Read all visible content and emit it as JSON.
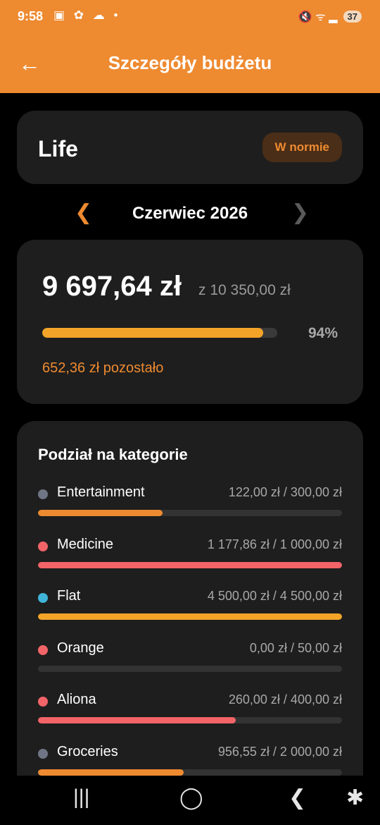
{
  "status": {
    "time": "9:58",
    "left_icons": "▣ ✿ ☁ •",
    "right_icons": "🔇 ᯤ ▂",
    "battery": "37"
  },
  "header": {
    "back_icon": "←",
    "title": "Szczegóły budżetu"
  },
  "budget": {
    "name": "Life",
    "status_badge": "W normie"
  },
  "month_nav": {
    "prev_icon": "❮",
    "label": "Czerwiec 2026",
    "next_icon": "❯"
  },
  "summary": {
    "spent": "9 697,64 zł",
    "limit": "z 10 350,00 zł",
    "percent_label": "94%",
    "progress": 0.94,
    "remaining": "652,36 zł pozostało",
    "bar_color": "#f3a428"
  },
  "categories": {
    "heading": "Podział na kategorie",
    "items": [
      {
        "name": "Entertainment",
        "amount": "122,00 zł / 300,00 zł",
        "progress": 0.41,
        "dot_color": "#6f7584",
        "bar_color": "#ee8a30"
      },
      {
        "name": "Medicine",
        "amount": "1 177,86 zł / 1 000,00 zł",
        "progress": 1.0,
        "dot_color": "#f26468",
        "bar_color": "#f26468"
      },
      {
        "name": "Flat",
        "amount": "4 500,00 zł / 4 500,00 zł",
        "progress": 1.0,
        "dot_color": "#3fb4d8",
        "bar_color": "#f3a428"
      },
      {
        "name": "Orange",
        "amount": "0,00 zł / 50,00 zł",
        "progress": 0.0,
        "dot_color": "#f26468",
        "bar_color": "#ee8a30"
      },
      {
        "name": "Aliona",
        "amount": "260,00 zł / 400,00 zł",
        "progress": 0.65,
        "dot_color": "#f26468",
        "bar_color": "#f26468"
      },
      {
        "name": "Groceries",
        "amount": "956,55 zł / 2 000,00 zł",
        "progress": 0.48,
        "dot_color": "#6f7584",
        "bar_color": "#ee8a30"
      }
    ]
  },
  "system_nav": {
    "recents_icon": "|||",
    "home_icon": "◯",
    "back_icon": "❮",
    "accessibility_icon": "✱"
  }
}
